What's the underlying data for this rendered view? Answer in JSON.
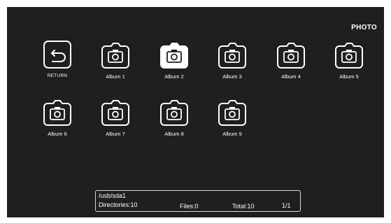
{
  "header": {
    "title": "PHOTO"
  },
  "return_item": {
    "label": "RETURN",
    "icon": "return-arrow-icon"
  },
  "albums": [
    {
      "label": "Album 1",
      "icon": "camera-folder-icon"
    },
    {
      "label": "Album 2",
      "icon": "camera-folder-icon",
      "selected": true
    },
    {
      "label": "Album 3",
      "icon": "camera-folder-icon"
    },
    {
      "label": "Album 4",
      "icon": "camera-folder-icon"
    },
    {
      "label": "Album 5",
      "icon": "camera-folder-icon"
    },
    {
      "label": "Album 6",
      "icon": "camera-folder-icon"
    },
    {
      "label": "Album 7",
      "icon": "camera-folder-icon"
    },
    {
      "label": "Album 8",
      "icon": "camera-folder-icon"
    },
    {
      "label": "Album 9",
      "icon": "camera-folder-icon"
    }
  ],
  "status": {
    "path": "/usb/sda1",
    "directories": "Directories:10",
    "files": "Files:0",
    "total": "Total:10",
    "page": "1/1"
  },
  "colors": {
    "background": "#1f1f1f",
    "foreground": "#ffffff",
    "selected_fill": "#ffffff"
  }
}
